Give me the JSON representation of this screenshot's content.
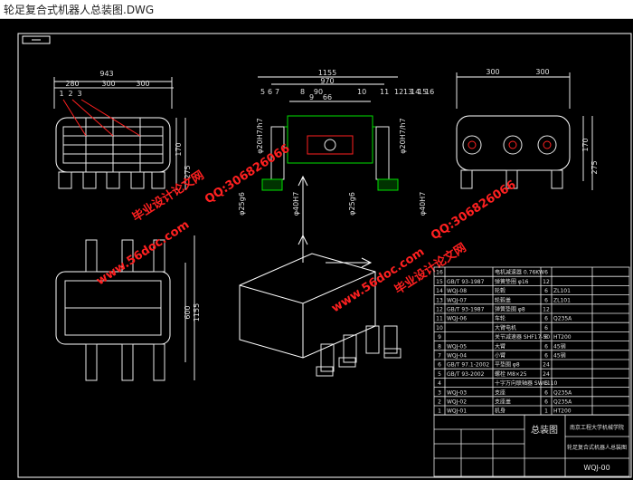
{
  "window": {
    "title": "轮足复合式机器人总装图.DWG"
  },
  "drawing": {
    "colors": {
      "frame": "#ffffff",
      "line": "#e8e8e8",
      "accent_green": "#00e000",
      "accent_red": "#ff2020",
      "accent_yellow": "#ffff00",
      "dim": "#d8d8d8"
    },
    "dims": {
      "w943": "943",
      "d280": "280",
      "d300a": "300",
      "d300b": "300",
      "w1155": "1155",
      "w970": "970",
      "d90": "90",
      "d66": "66",
      "h170a": "170",
      "h275a": "275",
      "h170b": "170",
      "h275b": "275",
      "d300top": "300",
      "d300top2": "300",
      "phi20a": "φ20H7/h7",
      "phi20b": "φ20H7/h7",
      "phi25a": "φ25g6",
      "phi25b": "φ25g6",
      "phi40a": "φ40H7",
      "phi40b": "φ40H7",
      "v600": "600",
      "v1155": "1155"
    },
    "callouts_left": [
      "1",
      "2",
      "3"
    ],
    "callouts_mid_left": [
      "5",
      "6",
      "7",
      "8",
      "9",
      "10"
    ],
    "callouts_mid_right": [
      "11",
      "12",
      "13",
      "14",
      "15",
      "16"
    ],
    "watermarks": [
      "毕业设计论文网",
      "www.56doc.com",
      "QQ:306826066",
      "QQ:306826066",
      "www.56doc.com",
      "毕业设计论文网"
    ]
  },
  "bom": {
    "rows": [
      {
        "no": "16",
        "code": "",
        "name": "电机减速器 0.76KW",
        "qty": "6",
        "mat": ""
      },
      {
        "no": "15",
        "code": "GB/T 93-1987",
        "name": "弹簧垫圈 φ16",
        "qty": "12",
        "mat": ""
      },
      {
        "no": "14",
        "code": "WQJ-08",
        "name": "轮毂",
        "qty": "6",
        "mat": "ZL101"
      },
      {
        "no": "13",
        "code": "WQJ-07",
        "name": "轮毂盖",
        "qty": "6",
        "mat": "ZL101"
      },
      {
        "no": "12",
        "code": "GB/T 93-1987",
        "name": "弹簧垫圈 φ8",
        "qty": "12",
        "mat": ""
      },
      {
        "no": "11",
        "code": "WQJ-06",
        "name": "车轮",
        "qty": "6",
        "mat": "Q235A"
      },
      {
        "no": "10",
        "code": "",
        "name": "大臂电机",
        "qty": "6",
        "mat": ""
      },
      {
        "no": "9",
        "code": "",
        "name": "关节减速器 SHF17-50",
        "qty": "6",
        "mat": "HT200"
      },
      {
        "no": "8",
        "code": "WQJ-05",
        "name": "大臂",
        "qty": "6",
        "mat": "45钢"
      },
      {
        "no": "7",
        "code": "WQJ-04",
        "name": "小臂",
        "qty": "6",
        "mat": "45钢"
      },
      {
        "no": "6",
        "code": "GB/T 97.1-2002",
        "name": "平垫圈 φ8",
        "qty": "24",
        "mat": ""
      },
      {
        "no": "5",
        "code": "GB/T 93-2002",
        "name": "螺栓 M8×25",
        "qty": "24",
        "mat": ""
      },
      {
        "no": "4",
        "code": "",
        "name": "十字万向联轴器 SWC110",
        "qty": "6",
        "mat": ""
      },
      {
        "no": "3",
        "code": "WQJ-03",
        "name": "支座",
        "qty": "6",
        "mat": "Q235A"
      },
      {
        "no": "2",
        "code": "WQJ-02",
        "name": "支座盖",
        "qty": "6",
        "mat": "Q235A"
      },
      {
        "no": "1",
        "code": "WQJ-01",
        "name": "机身",
        "qty": "1",
        "mat": "HT200"
      }
    ],
    "title": "总装图",
    "school": "南京工程大学机械学院",
    "drawing_name": "轮足复合式机器人总装图",
    "drawing_code": "WQJ-00"
  }
}
